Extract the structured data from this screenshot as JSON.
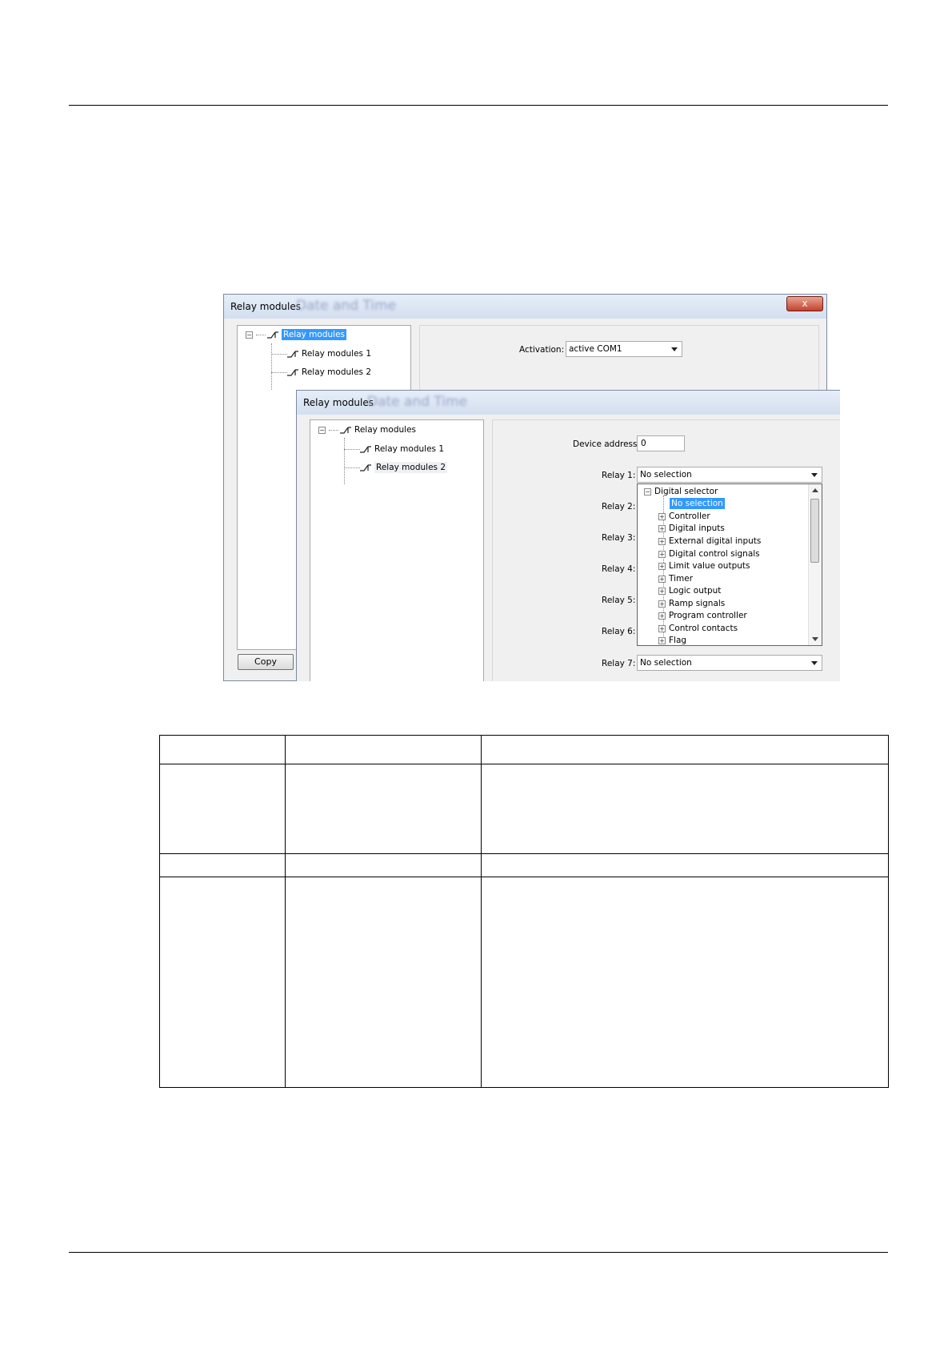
{
  "outer_dialog": {
    "title": "Relay modules",
    "blur_title": "Date and Time",
    "close_label": "x",
    "tree": {
      "root": "Relay modules",
      "child1": "Relay modules 1",
      "child2": "Relay modules 2"
    },
    "activation_label": "Activation:",
    "activation_value": "active COM1",
    "copy_button": "Copy"
  },
  "inner_dialog": {
    "title": "Relay modules",
    "blur_title": "Date and Time",
    "tree": {
      "root": "Relay modules",
      "child1": "Relay modules 1",
      "child2": "Relay modules 2"
    },
    "device_address_label": "Device address:",
    "device_address_value": "0",
    "relay_labels": [
      "Relay 1:",
      "Relay 2:",
      "Relay 3:",
      "Relay 4:",
      "Relay 5:",
      "Relay 6:",
      "Relay 7:"
    ],
    "relay1_value": "No selection",
    "relay7_value": "No selection",
    "dropdown": {
      "root": "Digital selector",
      "selected": "No selection",
      "items": [
        "Controller",
        "Digital inputs",
        "External digital inputs",
        "Digital control signals",
        "Limit value outputs",
        "Timer",
        "Logic output",
        "Ramp signals",
        "Program controller",
        "Control contacts",
        "Flag"
      ]
    }
  }
}
